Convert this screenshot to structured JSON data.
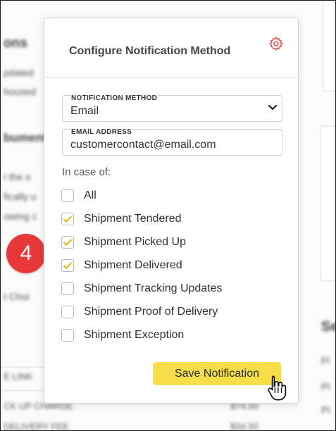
{
  "badge": {
    "number": "4",
    "color": "#e8393a"
  },
  "modal": {
    "title": "Configure Notification Method",
    "settings_icon": "gear-icon",
    "notification_method": {
      "label": "NOTIFICATION METHOD",
      "value": "Email"
    },
    "email_address": {
      "label": "EMAIL ADDRESS",
      "value": "customercontact@email.com"
    },
    "in_case_label": "In case of:",
    "options": [
      {
        "label": "All",
        "checked": false
      },
      {
        "label": "Shipment Tendered",
        "checked": true
      },
      {
        "label": "Shipment Picked Up",
        "checked": true
      },
      {
        "label": "Shipment Delivered",
        "checked": true
      },
      {
        "label": "Shipment Tracking Updates",
        "checked": false
      },
      {
        "label": "Shipment Proof of Delivery",
        "checked": false
      },
      {
        "label": "Shipment Exception",
        "checked": false
      }
    ],
    "save_label": "Save Notification"
  },
  "colors": {
    "accent_yellow": "#f5de4a",
    "checkbox_tick": "#e8b400",
    "gear": "#e0504a"
  },
  "background": {
    "fragments": [
      "ons",
      "pdated",
      "housed",
      "bument",
      "I the s",
      "fically u",
      "owing c",
      "t Choi",
      "E LINK",
      "CK UP CHARGE",
      "$74.50",
      "DELIVERY FEE",
      "$34.50",
      "Pl",
      "Fl",
      "Se",
      "Pi"
    ]
  }
}
